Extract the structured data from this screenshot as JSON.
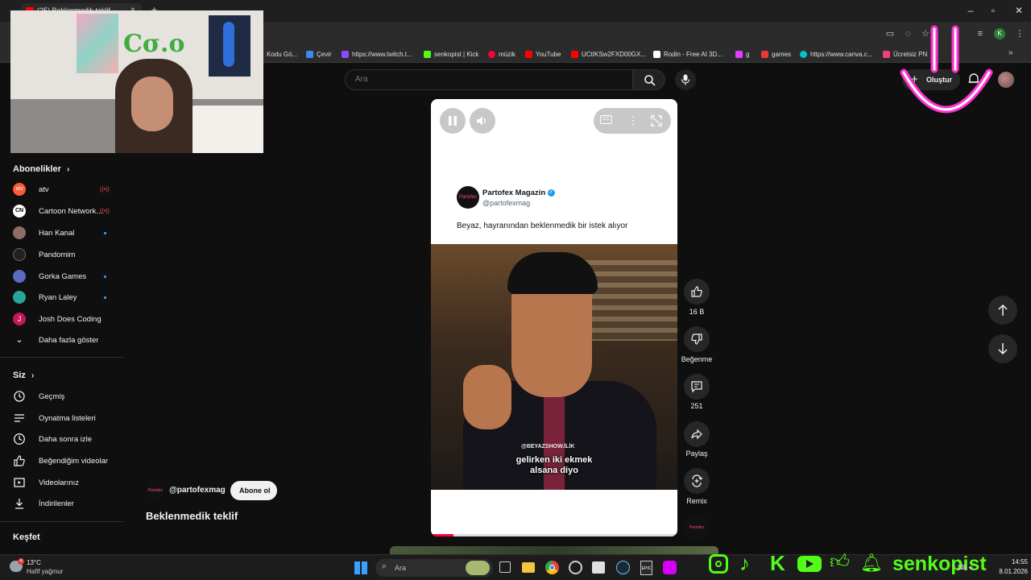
{
  "browser": {
    "tab_title": "(25) Beklenmedik teklif",
    "bookmarks": [
      {
        "label": "Kodu Gö...",
        "color": "#4a4a4a"
      },
      {
        "label": "Çevir",
        "color": "#4285f4"
      },
      {
        "label": "https://www.twitch.t...",
        "color": "#9146ff"
      },
      {
        "label": "senkopist | Kick",
        "color": "#53fc18"
      },
      {
        "label": "müzik",
        "color": "#ff0033"
      },
      {
        "label": "YouTube",
        "color": "#ff0000"
      },
      {
        "label": "UCtIKSw2FXD00GX...",
        "color": "#ff0000"
      },
      {
        "label": "Rodin - Free AI 3D...",
        "color": "#ffffff"
      },
      {
        "label": "g",
        "color": "#e040fb"
      },
      {
        "label": "games",
        "color": "#e53935"
      },
      {
        "label": "https://www.canva.c...",
        "color": "#00c4cc"
      },
      {
        "label": "Ücretsiz PN",
        "color": "#ec407a"
      }
    ]
  },
  "header": {
    "search_placeholder": "Ara",
    "create_label": "Oluştur"
  },
  "sidebar": {
    "subscriptions_title": "Abonelikler",
    "subscriptions": [
      {
        "label": "atv",
        "color": "#ff5a36",
        "badge": "live"
      },
      {
        "label": "Cartoon Network...",
        "color": "#ffffff",
        "badge": "live"
      },
      {
        "label": "Han Kanal",
        "color": "#8d6e63",
        "badge": "dot"
      },
      {
        "label": "Pandomim",
        "color": "#212121",
        "badge": ""
      },
      {
        "label": "Gorka Games",
        "color": "#5c6bc0",
        "badge": "dot"
      },
      {
        "label": "Ryan Laley",
        "color": "#26a69a",
        "badge": "dot"
      },
      {
        "label": "Josh Does Coding",
        "color": "#c2185b",
        "badge": ""
      }
    ],
    "show_more": "Daha fazla göster",
    "you_title": "Siz",
    "you_items": [
      {
        "label": "Geçmiş",
        "icon": "history-icon"
      },
      {
        "label": "Oynatma listeleri",
        "icon": "playlist-icon"
      },
      {
        "label": "Daha sonra izle",
        "icon": "clock-icon"
      },
      {
        "label": "Beğendiğim videolar",
        "icon": "thumbs-up-icon"
      },
      {
        "label": "Videolarınız",
        "icon": "video-icon"
      },
      {
        "label": "İndirilenler",
        "icon": "download-icon"
      }
    ],
    "explore_title": "Keşfet"
  },
  "short": {
    "tweet_name": "Partofex Magazin",
    "tweet_handle": "@partofexmag",
    "tweet_text": "Beyaz, hayranından beklenmedik bir istek alıyor",
    "video_watermark": "@BEYAZSHOW.İLİK",
    "subtitle_line1": "gelirken iki ekmek",
    "subtitle_line2": "alsana diyo",
    "progress": 0.09
  },
  "channel": {
    "handle": "@partofexmag",
    "subscribe_label": "Abone ol",
    "video_title": "Beklenmedik teklif"
  },
  "actions": {
    "likes": "16 B",
    "dislike": "Beğenme",
    "comments": "251",
    "share": "Paylaş",
    "remix": "Remix"
  },
  "taskbar": {
    "weather_temp": "13°C",
    "weather_desc": "Hafif yağmur",
    "search_placeholder": "Ara",
    "time": "14:55",
    "date": "8.01.2026"
  },
  "stream_overlay": {
    "username": "senkopist",
    "accent": "#53fc18"
  }
}
